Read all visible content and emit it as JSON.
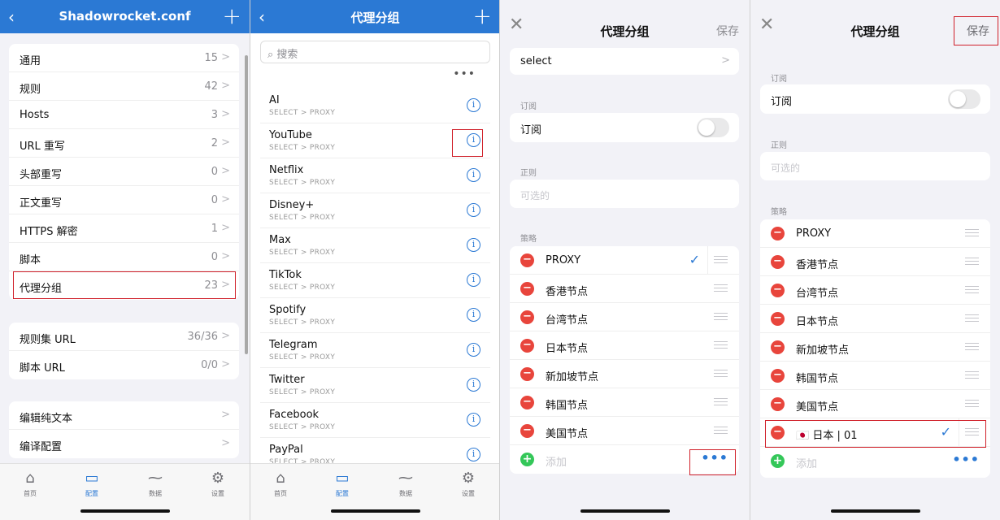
{
  "panel1": {
    "title": "Shadowrocket.conf",
    "back_icon": "‹",
    "plus_icon": "+",
    "groupA": [
      {
        "label": "通用",
        "value": "15"
      },
      {
        "label": "规则",
        "value": "42"
      },
      {
        "label": "Hosts",
        "value": "3"
      },
      {
        "label": "URL 重写",
        "value": "2"
      },
      {
        "label": "头部重写",
        "value": "0"
      },
      {
        "label": "正文重写",
        "value": "0"
      },
      {
        "label": "HTTPS 解密",
        "value": "1"
      },
      {
        "label": "脚本",
        "value": "0"
      },
      {
        "label": "代理分组",
        "value": "23"
      }
    ],
    "groupB": [
      {
        "label": "规则集 URL",
        "value": "36/36"
      },
      {
        "label": "脚本 URL",
        "value": "0/0"
      }
    ],
    "groupC": [
      {
        "label": "编辑纯文本",
        "value": ""
      },
      {
        "label": "编译配置",
        "value": ""
      }
    ]
  },
  "tabbar": [
    {
      "label": "首页",
      "icon": "⌂"
    },
    {
      "label": "配置",
      "icon": "▭"
    },
    {
      "label": "数据",
      "icon": "⁓"
    },
    {
      "label": "设置",
      "icon": "⚙"
    }
  ],
  "panel2": {
    "title": "代理分组",
    "search_placeholder": "搜索",
    "dots": "•••",
    "groups": [
      {
        "name": "AI",
        "sub": "SELECT > PROXY"
      },
      {
        "name": "YouTube",
        "sub": "SELECT > PROXY"
      },
      {
        "name": "Netflix",
        "sub": "SELECT > PROXY"
      },
      {
        "name": "Disney+",
        "sub": "SELECT > PROXY"
      },
      {
        "name": "Max",
        "sub": "SELECT > PROXY"
      },
      {
        "name": "TikTok",
        "sub": "SELECT > PROXY"
      },
      {
        "name": "Spotify",
        "sub": "SELECT > PROXY"
      },
      {
        "name": "Telegram",
        "sub": "SELECT > PROXY"
      },
      {
        "name": "Twitter",
        "sub": "SELECT > PROXY"
      },
      {
        "name": "Facebook",
        "sub": "SELECT > PROXY"
      },
      {
        "name": "PayPal",
        "sub": "SELECT > PROXY"
      }
    ]
  },
  "panel3": {
    "title": "代理分组",
    "save": "保存",
    "close_icon": "✕",
    "type_value": "select",
    "sub_header": "订阅",
    "sub_label": "订阅",
    "regex_header": "正则",
    "regex_placeholder": "可选的",
    "policy_header": "策略",
    "policies": [
      "PROXY",
      "香港节点",
      "台湾节点",
      "日本节点",
      "新加坡节点",
      "韩国节点",
      "美国节点"
    ],
    "add_label": "添加"
  },
  "panel4": {
    "title": "代理分组",
    "save": "保存",
    "close_icon": "✕",
    "sub_header": "订阅",
    "sub_label": "订阅",
    "regex_header": "正则",
    "regex_placeholder": "可选的",
    "policy_header": "策略",
    "policies": [
      "PROXY",
      "香港节点",
      "台湾节点",
      "日本节点",
      "新加坡节点",
      "韩国节点",
      "美国节点"
    ],
    "new_policy": "日本 | 01",
    "new_policy_flag": "🇯🇵",
    "add_label": "添加"
  },
  "colors": {
    "accent": "#2b79d4",
    "highlight": "#d0202a",
    "delete": "#e8453c",
    "add": "#34c759"
  }
}
